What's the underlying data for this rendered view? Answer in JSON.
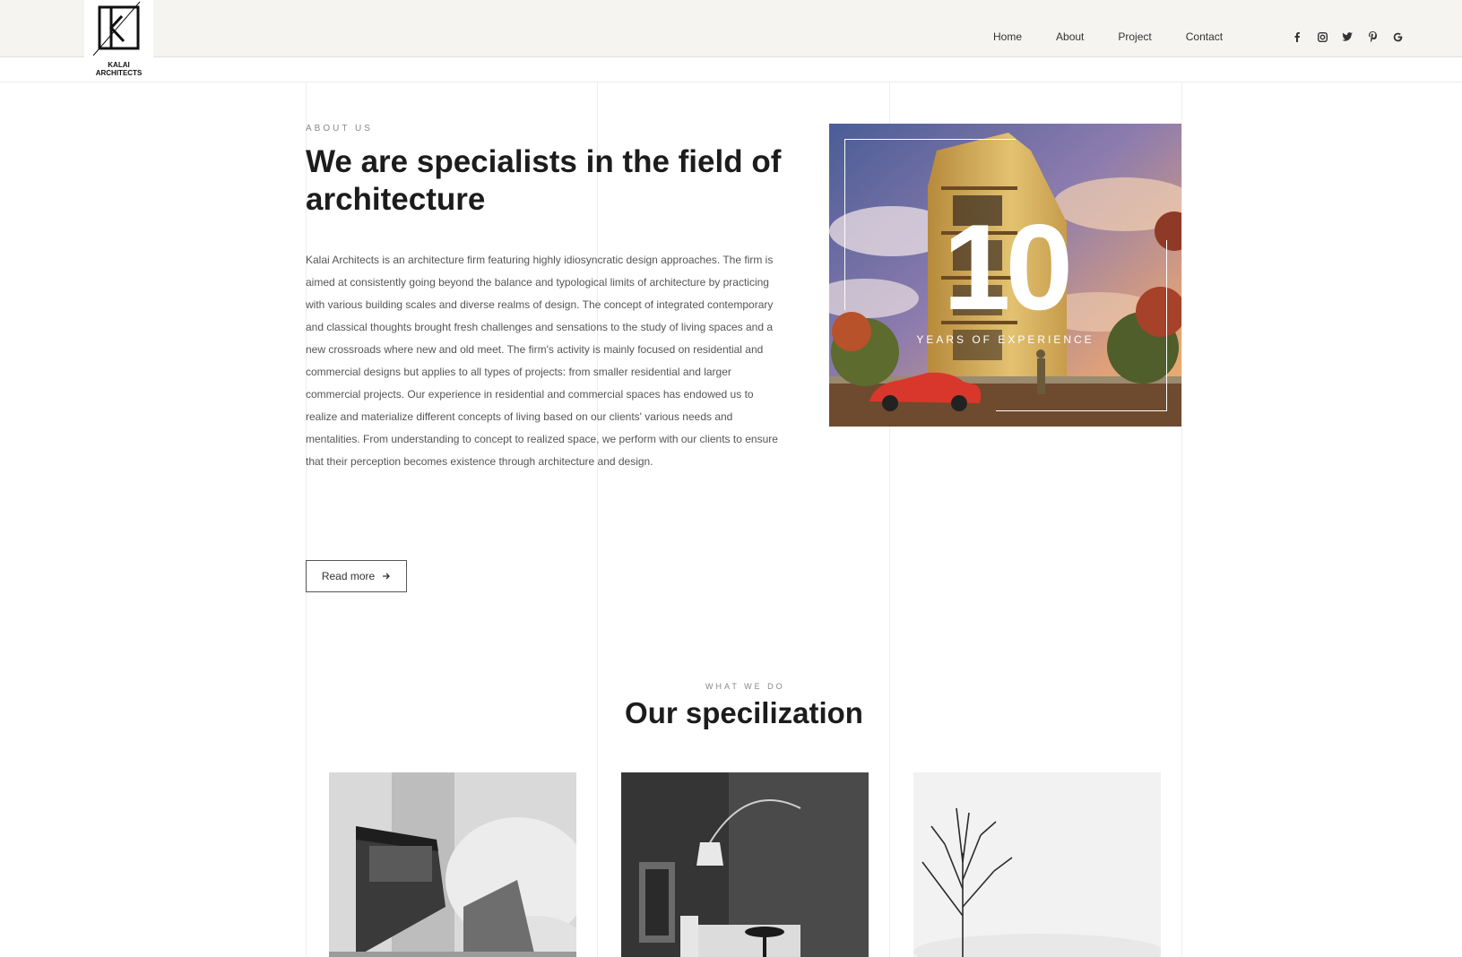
{
  "header": {
    "logo": {
      "line1": "KALAI",
      "line2": "ARCHITECTS"
    },
    "nav": [
      {
        "label": "Home"
      },
      {
        "label": "About"
      },
      {
        "label": "Project"
      },
      {
        "label": "Contact"
      }
    ],
    "social_icons": [
      "facebook-icon",
      "instagram-icon",
      "twitter-icon",
      "pinterest-icon",
      "google-icon"
    ]
  },
  "about": {
    "eyebrow": "ABOUT US",
    "title": "We are specialists in the field of architecture",
    "body": "Kalai Architects is an architecture firm featuring highly idiosyncratic design approaches. The firm is aimed at consistently going beyond the balance and typological limits of architecture by practicing with various building scales and diverse realms of design. The concept of integrated contemporary and classical thoughts brought fresh challenges and sensations to the study of living spaces and a new crossroads where new and old meet. The firm's activity is mainly focused on residential and commercial designs but applies to all types of projects: from smaller residential and larger commercial projects. Our experience in residential and commercial spaces has endowed us to realize and materialize different concepts of living based on our clients' various needs and mentalities. From understanding to concept to realized space, we perform with our clients to ensure that their perception becomes existence through architecture and design.",
    "read_more": "Read more",
    "experience": {
      "number": "10",
      "label": "YEARS OF EXPERIENCE"
    }
  },
  "specialization": {
    "eyebrow": "WHAT WE DO",
    "title": "Our specilization"
  },
  "colors": {
    "header_bg": "#f6f4f1",
    "heading": "#1c1c1c",
    "body_text": "#555555",
    "accent_white": "#ffffff"
  }
}
